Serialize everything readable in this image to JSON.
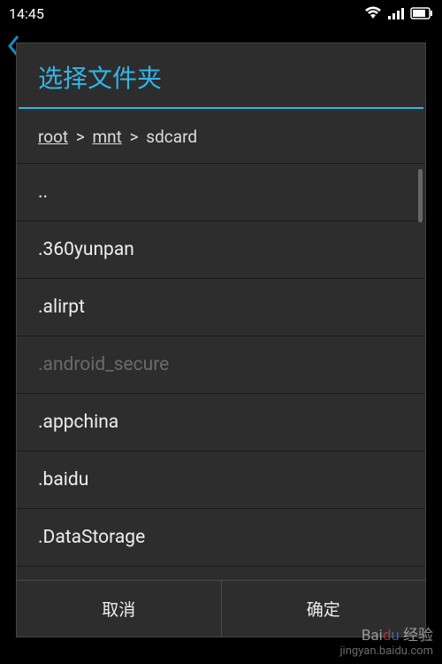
{
  "statusBar": {
    "time": "14:45"
  },
  "dialog": {
    "title": "选择文件夹",
    "breadcrumb": {
      "parts": [
        "root",
        "mnt",
        "sdcard"
      ],
      "linkedCount": 2
    },
    "items": [
      {
        "label": "..",
        "disabled": false
      },
      {
        "label": ".360yunpan",
        "disabled": false
      },
      {
        "label": ".alirpt",
        "disabled": false
      },
      {
        "label": ".android_secure",
        "disabled": true
      },
      {
        "label": ".appchina",
        "disabled": false
      },
      {
        "label": ".baidu",
        "disabled": false
      },
      {
        "label": ".DataStorage",
        "disabled": false
      }
    ],
    "buttons": {
      "cancel": "取消",
      "confirm": "确定"
    }
  },
  "watermark": {
    "brand": "Baidu 经验",
    "url": "jingyan.baidu.com"
  }
}
